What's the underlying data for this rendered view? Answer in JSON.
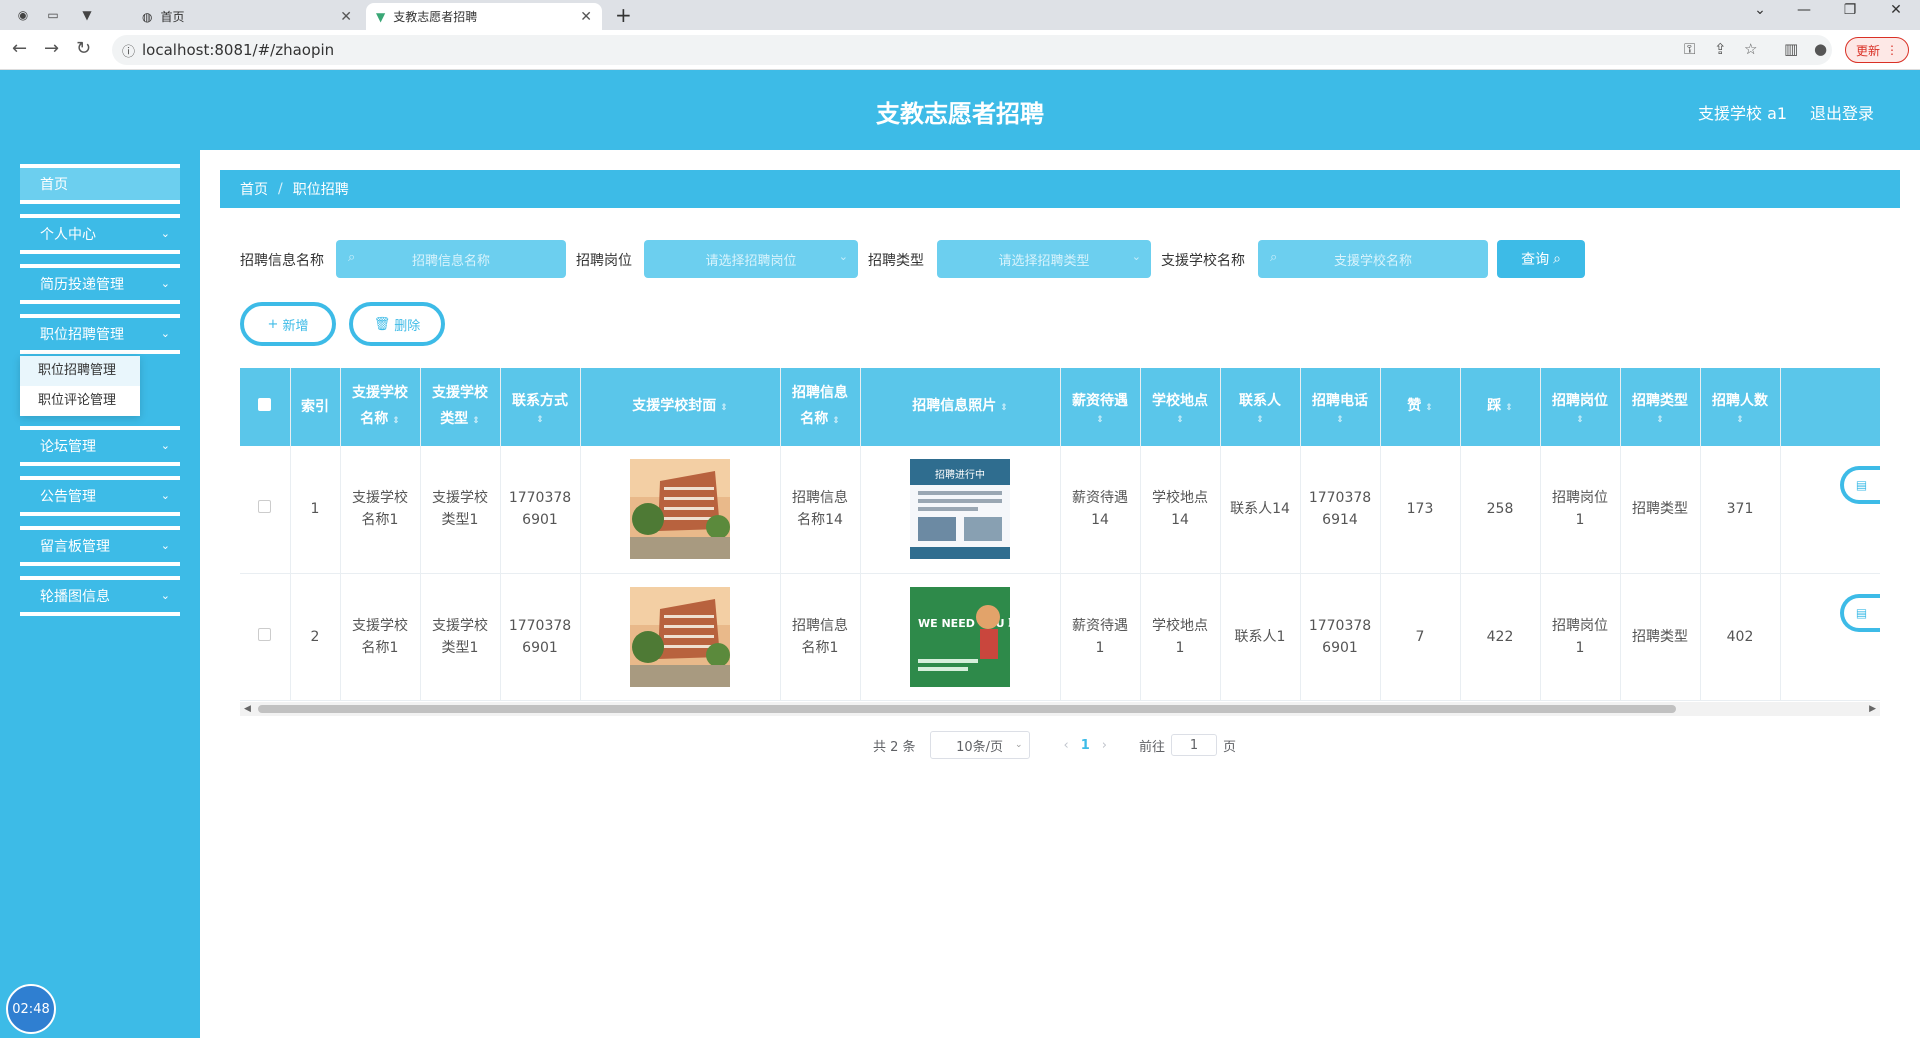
{
  "browser": {
    "tabs": [
      {
        "title": "首页",
        "active": false
      },
      {
        "title": "支教志愿者招聘",
        "active": true
      }
    ],
    "url": "localhost:8081/#/zhaopin",
    "update_label": "更新"
  },
  "header": {
    "title": "支教志愿者招聘",
    "user": "支援学校 a1",
    "logout": "退出登录"
  },
  "sidebar": {
    "items": [
      {
        "label": "首页"
      },
      {
        "label": "个人中心"
      },
      {
        "label": "简历投递管理"
      },
      {
        "label": "职位招聘管理"
      },
      {
        "label": "论坛管理"
      },
      {
        "label": "公告管理"
      },
      {
        "label": "留言板管理"
      },
      {
        "label": "轮播图信息"
      }
    ],
    "submenu": [
      "职位招聘管理",
      "职位评论管理"
    ],
    "timer": "02:48"
  },
  "breadcrumb": {
    "home": "首页",
    "current": "职位招聘"
  },
  "filters": {
    "name_label": "招聘信息名称",
    "name_placeholder": "招聘信息名称",
    "position_label": "招聘岗位",
    "position_placeholder": "请选择招聘岗位",
    "type_label": "招聘类型",
    "type_placeholder": "请选择招聘类型",
    "school_label": "支援学校名称",
    "school_placeholder": "支援学校名称",
    "search_label": "查询"
  },
  "actions": {
    "add": "新增",
    "delete": "删除"
  },
  "table": {
    "headers": [
      {
        "line1": "",
        "line2": ""
      },
      {
        "line1": "索引",
        "line2": ""
      },
      {
        "line1": "支援学校",
        "line2": "名称"
      },
      {
        "line1": "支援学校",
        "line2": "类型"
      },
      {
        "line1": "联系方式",
        "line2": ""
      },
      {
        "line1": "支援学校封面",
        "line2": ""
      },
      {
        "line1": "招聘信息",
        "line2": "名称"
      },
      {
        "line1": "招聘信息照片",
        "line2": ""
      },
      {
        "line1": "薪资待遇",
        "line2": ""
      },
      {
        "line1": "学校地点",
        "line2": ""
      },
      {
        "line1": "联系人",
        "line2": ""
      },
      {
        "line1": "招聘电话",
        "line2": ""
      },
      {
        "line1": "赞",
        "line2": ""
      },
      {
        "line1": "踩",
        "line2": ""
      },
      {
        "line1": "招聘岗位",
        "line2": ""
      },
      {
        "line1": "招聘类型",
        "line2": ""
      },
      {
        "line1": "招聘人数",
        "line2": ""
      }
    ],
    "rows": [
      {
        "index": "1",
        "school_name": [
          "支援学校",
          "名称1"
        ],
        "school_type": [
          "支援学校",
          "类型1"
        ],
        "contact": [
          "1770378",
          "6901"
        ],
        "info_name": [
          "招聘信息",
          "名称14"
        ],
        "salary": [
          "薪资待遇",
          "14"
        ],
        "location": [
          "学校地点",
          "14"
        ],
        "person": "联系人14",
        "phone": [
          "1770378",
          "6914"
        ],
        "likes": "173",
        "dislikes": "258",
        "position": [
          "招聘岗位",
          "1"
        ],
        "rtype": "招聘类型",
        "count": "371",
        "photo_caption": "招聘进行中"
      },
      {
        "index": "2",
        "school_name": [
          "支援学校",
          "名称1"
        ],
        "school_type": [
          "支援学校",
          "类型1"
        ],
        "contact": [
          "1770378",
          "6901"
        ],
        "info_name": [
          "招聘信息",
          "名称1"
        ],
        "salary": [
          "薪资待遇",
          "1"
        ],
        "location": [
          "学校地点",
          "1"
        ],
        "person": "联系人1",
        "phone": [
          "1770378",
          "6901"
        ],
        "likes": "7",
        "dislikes": "422",
        "position": [
          "招聘岗位",
          "1"
        ],
        "rtype": "招聘类型",
        "count": "402",
        "photo_caption": "WE NEED YOU 聘"
      }
    ]
  },
  "pagination": {
    "total": "共 2 条",
    "page_size": "10条/页",
    "current": "1",
    "goto_label": "前往",
    "goto_value": "1",
    "page_suffix": "页"
  },
  "colors": {
    "primary": "#3dbbe7",
    "light": "#6ccfef"
  }
}
